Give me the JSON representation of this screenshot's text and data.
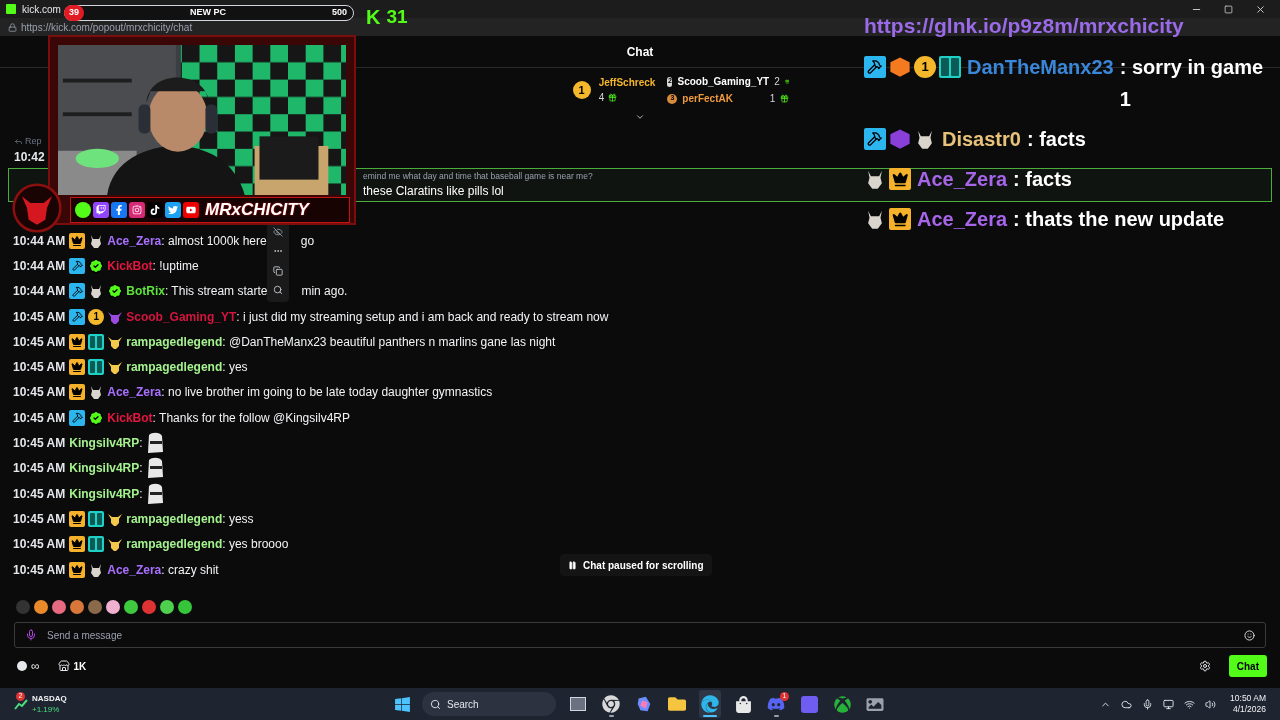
{
  "browser": {
    "title": "kick.com",
    "address": "https://kick.com/popout/mrxchicity/chat"
  },
  "overlay": {
    "goal_count": "39",
    "goal_label": "NEW PC",
    "goal_target": "500",
    "follow_mark": "K",
    "follow_count": "31",
    "brand": "MRxCHICITY",
    "link": "https://glnk.io/p9z8m/mrxchicity",
    "chat": [
      {
        "badges": [
          {
            "kind": "mod"
          },
          {
            "kind": "cube",
            "color": "#f47a1f"
          },
          {
            "kind": "rank",
            "label": "1"
          },
          {
            "kind": "og"
          }
        ],
        "name": "DanTheManx23",
        "color": "#3a86d8",
        "text": ": sorry in game 1"
      },
      {
        "badges": [
          {
            "kind": "mod"
          },
          {
            "kind": "cube",
            "color": "#8b3fd9"
          },
          {
            "kind": "goat"
          }
        ],
        "name": "Disastr0",
        "color": "#e9c27a",
        "text": ": facts"
      },
      {
        "badges": [
          {
            "kind": "goat"
          },
          {
            "kind": "crown"
          }
        ],
        "name": "Ace_Zera",
        "color": "#a765ea",
        "text": ": facts"
      },
      {
        "badges": [
          {
            "kind": "goat"
          },
          {
            "kind": "crown"
          }
        ],
        "name": "Ace_Zera",
        "color": "#a765ea",
        "text": ": thats the new update"
      }
    ]
  },
  "chat": {
    "title": "Chat",
    "leaders": [
      {
        "rank": "1",
        "name": "JeffSchreck",
        "count": "4"
      },
      {
        "rank": "2",
        "name": "Scoob_Gaming_YT",
        "count": "2"
      },
      {
        "rank": "3",
        "name": "perFectAK",
        "count": "1"
      }
    ],
    "reply_label": "Rep",
    "reply_time": "10:42",
    "highlight": {
      "reply": "emind me what day and time that baseball game is near me?",
      "text": "these Claratins like pills lol"
    },
    "messages": [
      {
        "kind": "text",
        "time": "10:44 AM",
        "badges": [
          {
            "kind": "crown"
          },
          {
            "kind": "goat"
          }
        ],
        "name": "Ace_Zera",
        "color": "#a970ff",
        "text": ": almost 1000k here",
        "text_after": "go"
      },
      {
        "kind": "text",
        "time": "10:44 AM",
        "badges": [
          {
            "kind": "mod"
          },
          {
            "kind": "verified"
          }
        ],
        "name": "KickBot",
        "color": "#e3163f",
        "text": ": !uptime"
      },
      {
        "kind": "text",
        "time": "10:44 AM",
        "badges": [
          {
            "kind": "mod"
          },
          {
            "kind": "goat"
          },
          {
            "kind": "verified"
          }
        ],
        "name": "BotRix",
        "color": "#5ee33a",
        "text": ": This stream starte",
        "text_after": "min ago."
      },
      {
        "kind": "text",
        "time": "10:45 AM",
        "badges": [
          {
            "kind": "mod"
          },
          {
            "kind": "rank",
            "label": "1"
          },
          {
            "kind": "bull",
            "color": "#9b4be0"
          }
        ],
        "name": "Scoob_Gaming_YT",
        "color": "#d4153d",
        "text": ": i just did my streaming setup and i am back and ready to stream now"
      },
      {
        "kind": "text",
        "time": "10:45 AM",
        "badges": [
          {
            "kind": "crown"
          },
          {
            "kind": "og"
          },
          {
            "kind": "bull",
            "color": "#f2c94c"
          }
        ],
        "name": "rampagedlegend",
        "color": "#a4f28e",
        "text": ": @DanTheManx23 beautiful panthers n marlins gane las night"
      },
      {
        "kind": "text",
        "time": "10:45 AM",
        "badges": [
          {
            "kind": "crown"
          },
          {
            "kind": "og"
          },
          {
            "kind": "bull",
            "color": "#f2c94c"
          }
        ],
        "name": "rampagedlegend",
        "color": "#a4f28e",
        "text": ": yes"
      },
      {
        "kind": "text",
        "time": "10:45 AM",
        "badges": [
          {
            "kind": "crown"
          },
          {
            "kind": "goat"
          }
        ],
        "name": "Ace_Zera",
        "color": "#a970ff",
        "text": ": no live brother im going to be late today daughter gymnastics"
      },
      {
        "kind": "text",
        "time": "10:45 AM",
        "badges": [
          {
            "kind": "mod"
          },
          {
            "kind": "verified"
          }
        ],
        "name": "KickBot",
        "color": "#e3163f",
        "text": ": Thanks for the follow @Kingsilv4RP"
      },
      {
        "kind": "emote",
        "time": "10:45 AM",
        "name": "Kingsilv4RP",
        "color": "#a4f28e",
        "text": ":"
      },
      {
        "kind": "emote",
        "time": "10:45 AM",
        "name": "Kingsilv4RP",
        "color": "#a4f28e",
        "text": ":"
      },
      {
        "kind": "emote",
        "time": "10:45 AM",
        "name": "Kingsilv4RP",
        "color": "#a4f28e",
        "text": ":"
      },
      {
        "kind": "text",
        "time": "10:45 AM",
        "badges": [
          {
            "kind": "crown"
          },
          {
            "kind": "og"
          },
          {
            "kind": "bull",
            "color": "#f2c94c"
          }
        ],
        "name": "rampagedlegend",
        "color": "#a4f28e",
        "text": ": yess"
      },
      {
        "kind": "text",
        "time": "10:45 AM",
        "badges": [
          {
            "kind": "crown"
          },
          {
            "kind": "og"
          },
          {
            "kind": "bull",
            "color": "#f2c94c"
          }
        ],
        "name": "rampagedlegend",
        "color": "#a4f28e",
        "text": ": yes broooo"
      },
      {
        "kind": "text",
        "time": "10:45 AM",
        "badges": [
          {
            "kind": "crown"
          },
          {
            "kind": "goat"
          }
        ],
        "name": "Ace_Zera",
        "color": "#a970ff",
        "text": ": crazy shit"
      }
    ],
    "paused": "Chat paused for scrolling",
    "placeholder": "Send a message",
    "points": "∞",
    "store": "1K",
    "send": "Chat"
  },
  "taskbar": {
    "widget_badge": "2",
    "widget_name": "NASDAQ",
    "widget_change": "+1.19%",
    "search": "Search",
    "apps": [
      {
        "kind": "taskview",
        "running": false,
        "selected": false
      },
      {
        "kind": "chrome",
        "running": true,
        "selected": false
      },
      {
        "kind": "copilot",
        "running": false,
        "selected": false
      },
      {
        "kind": "folder",
        "running": false,
        "selected": false
      },
      {
        "kind": "edge",
        "running": true,
        "selected": true
      },
      {
        "kind": "store",
        "running": false,
        "selected": false
      },
      {
        "kind": "discord",
        "running": true,
        "selected": false,
        "badge": "1"
      },
      {
        "kind": "grid",
        "running": false,
        "selected": false
      },
      {
        "kind": "xbox",
        "running": false,
        "selected": false
      },
      {
        "kind": "photos",
        "running": false,
        "selected": false
      }
    ],
    "time": "10:50 AM",
    "date": "4/1/2026"
  }
}
